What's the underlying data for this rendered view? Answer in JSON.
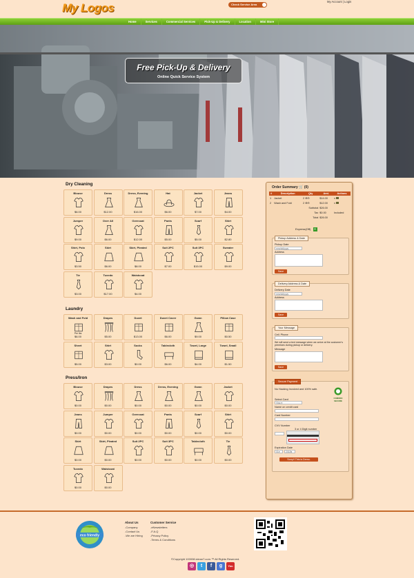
{
  "header": {
    "logo": "My Logos",
    "service_area_label": "Check Service Area",
    "account_links": "My Account | Login"
  },
  "nav": [
    "Home",
    "Services",
    "Commercial Services",
    "Pick-Up & Delivery",
    "Location",
    "Mini Store"
  ],
  "hero": {
    "title": "Free Pick-Up & Delivery",
    "subtitle": "Online Quick Service System"
  },
  "sections": [
    {
      "title": "Dry Cleaning",
      "items": [
        {
          "name": "Blouse",
          "price": "$6.00",
          "icon": "blouse-icon"
        },
        {
          "name": "Dress",
          "price": "$12.00",
          "icon": "dress-icon"
        },
        {
          "name": "Dress, Evening",
          "price": "$16.00",
          "icon": "evening-dress-icon"
        },
        {
          "name": "Hat",
          "price": "$6.00",
          "icon": "hat-icon"
        },
        {
          "name": "Jacket",
          "price": "$7.00",
          "icon": "jacket-icon"
        },
        {
          "name": "Jeans",
          "price": "$4.00",
          "icon": "jeans-icon"
        },
        {
          "name": "Jumper",
          "price": "$9.00",
          "icon": "jumper-icon"
        },
        {
          "name": "Over All",
          "price": "$6.00",
          "icon": "overall-icon"
        },
        {
          "name": "Overcoat",
          "price": "$12.00",
          "icon": "overcoat-icon"
        },
        {
          "name": "Pants",
          "price": "$5.00",
          "icon": "pants-icon"
        },
        {
          "name": "Scarf",
          "price": "$5.00",
          "icon": "scarf-icon"
        },
        {
          "name": "Shirt",
          "price": "$2.80",
          "icon": "shirt-icon"
        },
        {
          "name": "Shirt, Polo",
          "price": "$3.50",
          "icon": "polo-shirt-icon"
        },
        {
          "name": "Skirt",
          "price": "$6.00",
          "icon": "skirt-icon"
        },
        {
          "name": "Skirt, Pleated",
          "price": "$8.00",
          "icon": "pleated-skirt-icon"
        },
        {
          "name": "Suit 2PC",
          "price": "$7.00",
          "icon": "suit-2pc-icon"
        },
        {
          "name": "Suit 3PC",
          "price": "$15.00",
          "icon": "suit-3pc-icon"
        },
        {
          "name": "Sweater",
          "price": "$9.00",
          "icon": "sweater-icon"
        },
        {
          "name": "Tie",
          "price": "$3.00",
          "icon": "tie-icon"
        },
        {
          "name": "Tuxedo",
          "price": "$17.00",
          "icon": "tuxedo-icon"
        },
        {
          "name": "Waistcoat",
          "price": "$4.00",
          "icon": "waistcoat-icon"
        }
      ]
    },
    {
      "title": "Laundry",
      "items": [
        {
          "name": "Wash and Fold",
          "price": "$6.00",
          "sub": "Per lbs",
          "icon": "wash-fold-icon"
        },
        {
          "name": "Drapes",
          "price": "$5.00",
          "icon": "drapes-icon"
        },
        {
          "name": "Duvet",
          "price": "$13.00",
          "icon": "duvet-icon"
        },
        {
          "name": "Duvet Cover",
          "price": "$6.00",
          "icon": "duvet-cover-icon"
        },
        {
          "name": "Gown",
          "price": "$9.00",
          "icon": "gown-icon"
        },
        {
          "name": "Pillow Case",
          "price": "$0.50",
          "icon": "pillow-case-icon"
        },
        {
          "name": "Sheet",
          "price": "$5.00",
          "icon": "sheet-icon"
        },
        {
          "name": "Shirt",
          "price": "$3.00",
          "icon": "shirt-icon"
        },
        {
          "name": "Socks",
          "price": "$0.00",
          "icon": "socks-icon"
        },
        {
          "name": "Tablecloth",
          "price": "$6.00",
          "icon": "tablecloth-icon"
        },
        {
          "name": "Towel, Large",
          "price": "$4.00",
          "icon": "towel-large-icon"
        },
        {
          "name": "Towel, Small",
          "price": "$1.50",
          "icon": "towel-small-icon"
        }
      ]
    },
    {
      "title": "Press/Iron",
      "items": [
        {
          "name": "Blouse",
          "price": "$0.00",
          "icon": "blouse-icon"
        },
        {
          "name": "Drapes",
          "price": "$0.00",
          "icon": "drapes-icon"
        },
        {
          "name": "Dress",
          "price": "$0.00",
          "icon": "dress-icon"
        },
        {
          "name": "Dress, Evening",
          "price": "$0.00",
          "icon": "evening-dress-icon"
        },
        {
          "name": "Gown",
          "price": "$0.00",
          "icon": "gown-icon"
        },
        {
          "name": "Jacket",
          "price": "$0.00",
          "icon": "jacket-icon"
        },
        {
          "name": "Jeans",
          "price": "$0.00",
          "icon": "jeans-icon"
        },
        {
          "name": "Jumper",
          "price": "$0.00",
          "icon": "jumper-icon"
        },
        {
          "name": "Overcoat",
          "price": "$0.00",
          "icon": "overcoat-icon"
        },
        {
          "name": "Pants",
          "price": "$0.00",
          "icon": "pants-icon"
        },
        {
          "name": "Scarf",
          "price": "$0.00",
          "icon": "scarf-icon"
        },
        {
          "name": "Shirt",
          "price": "$0.00",
          "icon": "shirt-icon"
        },
        {
          "name": "Skirt",
          "price": "$0.00",
          "icon": "skirt-icon"
        },
        {
          "name": "Skirt, Pleated",
          "price": "$0.00",
          "icon": "pleated-skirt-icon"
        },
        {
          "name": "Suit 2PC",
          "price": "$0.00",
          "icon": "suit-2pc-icon"
        },
        {
          "name": "Suit 3PC",
          "price": "$0.00",
          "icon": "suit-3pc-icon"
        },
        {
          "name": "Tablecloth",
          "price": "$0.00",
          "icon": "tablecloth-icon"
        },
        {
          "name": "Tie",
          "price": "$0.00",
          "icon": "tie-icon"
        },
        {
          "name": "Tuxedo",
          "price": "$0.00",
          "icon": "tuxedo-icon"
        },
        {
          "name": "Waistcoat",
          "price": "$0.00",
          "icon": "waistcoat-icon"
        }
      ]
    }
  ],
  "order": {
    "title": "Order Summary",
    "count": "(0)",
    "columns": [
      "#",
      "Description",
      "Qty",
      "Amt.",
      "Actions"
    ],
    "rows": [
      {
        "num": "1",
        "desc": "Jacket",
        "qty": "2",
        "amt": "$14.00",
        "action": "x"
      },
      {
        "num": "2",
        "desc": "Wash and Fold",
        "qty": "2",
        "amt": "$12.00",
        "action": "x"
      }
    ],
    "subtotal_label": "Subtotal",
    "subtotal": "$26.00",
    "tax_label": "Tax",
    "tax": "$0.00",
    "tax_note": "Included",
    "total_label": "Total",
    "total": "$26.00",
    "express_label": "Express(Off)",
    "pickup": {
      "tab": "Pickup Address & Date",
      "date_label": "Pickup Date",
      "date_placeholder": "mm/dd/yyyy",
      "address_label": "Address",
      "save": "Save"
    },
    "delivery": {
      "tab": "Delivery Address & Date",
      "date_label": "Delivery Date",
      "date_placeholder": "mm/dd/yyyy",
      "address_label": "Address",
      "save": "Save"
    },
    "message": {
      "tab": "Your Message",
      "phone_label": "Cell. Phone",
      "note": "We will send a text message when we arrive at the customer's premises during pickup or delivery.",
      "message_label": "Message",
      "save": "Save"
    },
    "payment": {
      "tab": "Secure Payment",
      "note": "No Hacking Involved and 100% safe.",
      "secure_badge": "COMODO SECURE",
      "card_label": "Select Card",
      "card_value": "Visa",
      "name_label": "Name on credit card",
      "number_label": "Card Number",
      "cvv_label": "CVV Number",
      "cvv_hint": "3 or 4 Digit number",
      "expiry_label": "Expiration Date",
      "exp_month": "01",
      "exp_year": "2018",
      "submit": "Sorry!! This is Demo."
    }
  },
  "footer": {
    "about_title": "About Us",
    "about_links": [
      "-Company",
      "-Contact Us",
      "-We are Hiring"
    ],
    "service_title": "Customer Service",
    "service_links": [
      "-eNewsletters",
      "-F.A.Q",
      "-Privacy Policy",
      "-Terms & Conditions"
    ],
    "badge_text": "eco friendly",
    "copyright": "©Copyright 100008.iclean7.com.™ All Rights Reserved."
  },
  "colors": {
    "accent": "#c5501c",
    "nav_green": "#6cb021",
    "background": "#fde4cb"
  }
}
